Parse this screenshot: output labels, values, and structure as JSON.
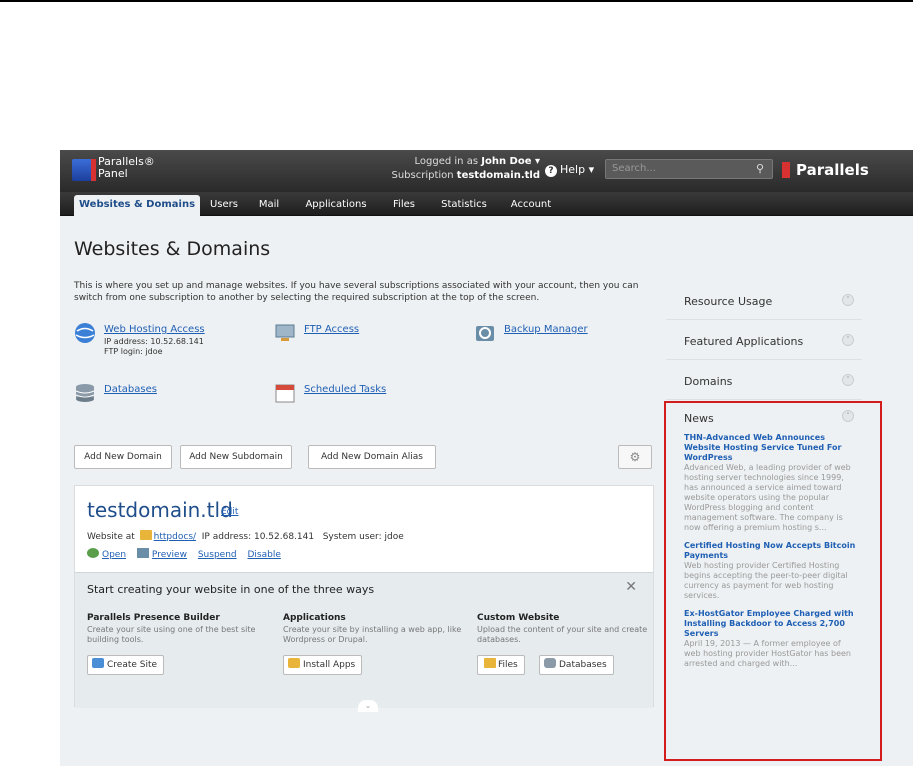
{
  "header": {
    "logo_line1": "Parallels®",
    "logo_line2": "Panel",
    "logged_in_label": "Logged in as",
    "user_name": "John Doe ▾",
    "subscription_label": "Subscription",
    "subscription_value": "testdomain.tld",
    "help_label": "Help ▾",
    "search_placeholder": "Search...",
    "brand": "Parallels"
  },
  "tabs": [
    "Websites & Domains",
    "Users",
    "Mail",
    "Applications",
    "Files",
    "Statistics",
    "Account"
  ],
  "page": {
    "title": "Websites & Domains",
    "intro": "This is where you set up and manage websites. If you have several subscriptions associated with your account, then you can switch from one subscription to another by selecting the required subscription at the top of the screen."
  },
  "tools": {
    "web_hosting": {
      "label": "Web Hosting Access",
      "ip": "IP address: 10.52.68.141",
      "ftp": "FTP login: jdoe"
    },
    "ftp_access": "FTP Access",
    "backup": "Backup Manager",
    "databases": "Databases",
    "scheduled": "Scheduled Tasks"
  },
  "buttons": {
    "add_domain": "Add New Domain",
    "add_subdomain": "Add New Subdomain",
    "add_alias": "Add New Domain Alias"
  },
  "domain": {
    "name": "testdomain.tld",
    "edit": "Edit",
    "website_at": "Website at",
    "docroot": "httpdocs/",
    "ip": "IP address: 10.52.68.141",
    "sysuser": "System user: jdoe",
    "actions": [
      "Open",
      "Preview",
      "Suspend",
      "Disable"
    ]
  },
  "start": {
    "title": "Start creating your website in one of the three ways",
    "columns": [
      {
        "heading": "Parallels Presence Builder",
        "desc": "Create your site using one of the best site building tools.",
        "buttons": [
          "Create Site"
        ]
      },
      {
        "heading": "Applications",
        "desc": "Create your site by installing a web app, like Wordpress or Drupal.",
        "buttons": [
          "Install Apps"
        ]
      },
      {
        "heading": "Custom Website",
        "desc": "Upload the content of your site and create databases.",
        "buttons": [
          "Files",
          "Databases"
        ]
      }
    ]
  },
  "sidebar": {
    "sections": [
      "Resource Usage",
      "Featured Applications",
      "Domains"
    ],
    "news_heading": "News",
    "news": [
      {
        "title": "THN-Advanced Web Announces Website Hosting Service Tuned For WordPress",
        "desc": "Advanced Web, a leading provider of web hosting server technologies since 1999, has announced a service aimed toward website operators using the popular WordPress blogging and content management software. The company is now offering a premium hosting s..."
      },
      {
        "title": "Certified Hosting Now Accepts Bitcoin Payments",
        "desc": "Web hosting provider Certified Hosting begins accepting the peer-to-peer digital currency as payment for web hosting services."
      },
      {
        "title": "Ex-HostGator Employee Charged with Installing Backdoor to Access 2,700 Servers",
        "desc": "April 19, 2013 — A former employee of web hosting provider HostGator has been arrested and charged with..."
      }
    ]
  }
}
